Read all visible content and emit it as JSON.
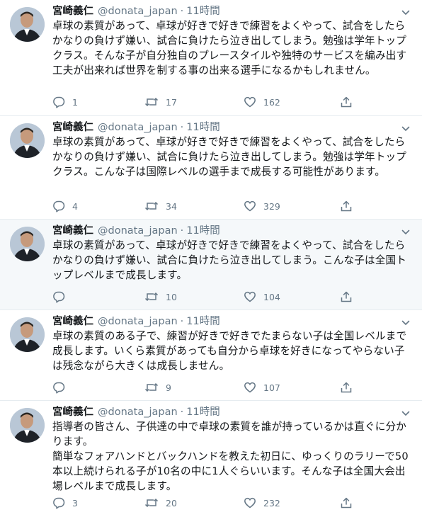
{
  "tweets": [
    {
      "name": "宮崎義仁",
      "handle": "@donata_japan",
      "time": "11時間",
      "text": "卓球の素質があって、卓球が好きで好きで練習をよくやって、試合をしたらかなりの負けず嫌い、試合に負けたら泣き出してしまう。勉強は学年トップクラス。そんな子が自分独自のプレースタイルや独特のサービスを編み出す工夫が出来れば世界を制する事の出来る選手になるかもしれません。",
      "replies": "1",
      "retweets": "17",
      "likes": "162"
    },
    {
      "name": "宮崎義仁",
      "handle": "@donata_japan",
      "time": "11時間",
      "text": "卓球の素質があって、卓球が好きで好きで練習をよくやって、試合をしたらかなりの負けず嫌い、試合に負けたら泣き出してしまう。勉強は学年トップクラス。こんな子は国際レベルの選手まで成長する可能性があります。",
      "replies": "4",
      "retweets": "34",
      "likes": "329"
    },
    {
      "name": "宮崎義仁",
      "handle": "@donata_japan",
      "time": "11時間",
      "text": "卓球の素質があって、卓球が好きで好きで練習をよくやって、試合をしたらかなりの負けず嫌い、試合に負けたら泣き出してしまう。こんな子は全国トップレベルまで成長します。",
      "replies": "",
      "retweets": "10",
      "likes": "104"
    },
    {
      "name": "宮崎義仁",
      "handle": "@donata_japan",
      "time": "11時間",
      "text": "卓球の素質のある子で、練習が好きで好きでたまらない子は全国レベルまで成長します。いくら素質があっても自分から卓球を好きになってやらない子は残念ながら大きくは成長しません。",
      "replies": "",
      "retweets": "9",
      "likes": "107"
    },
    {
      "name": "宮崎義仁",
      "handle": "@donata_japan",
      "time": "11時間",
      "text": "指導者の皆さん、子供達の中で卓球の素質を誰が持っているかは直ぐに分かります。\n簡単なフォアハンドとバックハンドを教えた初日に、ゆっくりのラリーで50本以上続けられる子が10名の中に1人ぐらいいます。そんな子は全国大会出場レベルまで成長します。",
      "replies": "3",
      "retweets": "20",
      "likes": "232"
    }
  ],
  "icons": {
    "reply": "reply-icon",
    "retweet": "retweet-icon",
    "like": "heart-icon",
    "share": "share-icon",
    "menu": "chevron-down-icon"
  },
  "colors": {
    "icon": "#657786",
    "divider": "#e6ecf0",
    "hover_bg": "#f5f8fa",
    "text": "#14171a"
  }
}
